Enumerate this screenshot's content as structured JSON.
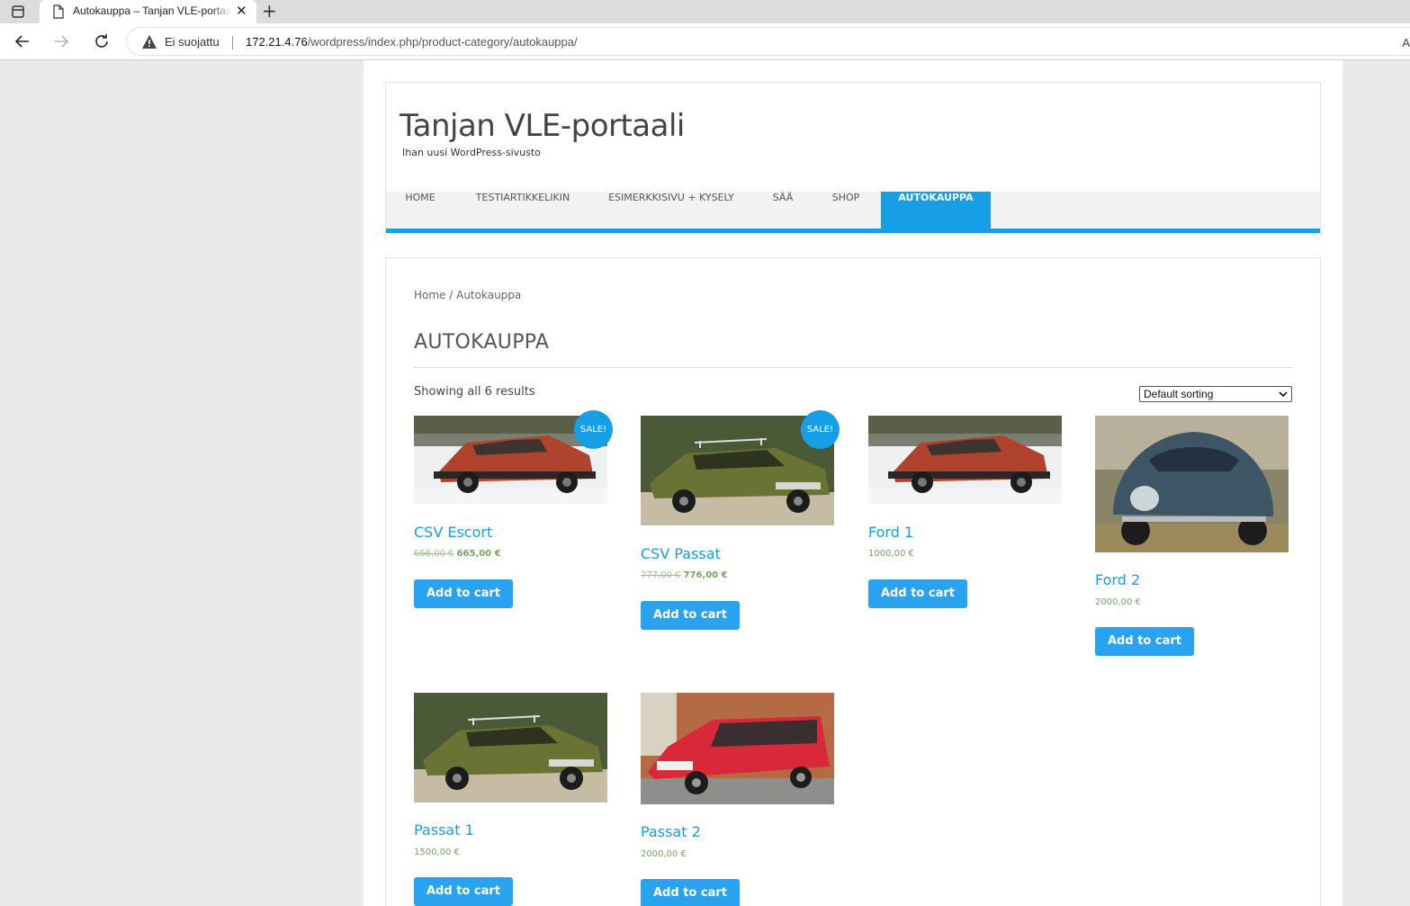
{
  "browser": {
    "tab_title": "Autokauppa – Tanjan VLE-portaali",
    "security_label": "Ei suojattu",
    "url_host": "172.21.4.76",
    "url_path": "/wordpress/index.php/product-category/autokauppa/",
    "new_tab_glyph": "+",
    "close_glyph": "✕",
    "reader_glyph": "A"
  },
  "site": {
    "title": "Tanjan VLE-portaali",
    "description": "Ihan uusi WordPress-sivusto"
  },
  "menu": {
    "items": [
      {
        "label": "Home"
      },
      {
        "label": "Testiartikkelikin"
      },
      {
        "label": "Esimerkkisivu + kysely"
      },
      {
        "label": "Sää"
      },
      {
        "label": "Shop"
      },
      {
        "label": "Autokauppa"
      }
    ],
    "active": "Autokauppa"
  },
  "breadcrumb": "Home / Autokauppa",
  "page_title": "Autokauppa",
  "result_count": "Showing all 6 results",
  "sorting": {
    "selected": "Default sorting"
  },
  "products": [
    {
      "title": "CSV Escort",
      "regular_price": "666,00 €",
      "sale_price": "665,00 €",
      "price": "",
      "sale_badge": "SALE!",
      "button": "Add to cart",
      "image": "red-hatchback-in-snow"
    },
    {
      "title": "CSV Passat",
      "regular_price": "777,00 €",
      "sale_price": "776,00 €",
      "price": "",
      "sale_badge": "SALE!",
      "button": "Add to cart",
      "image": "green-sedan-with-roof-rack"
    },
    {
      "title": "Ford 1",
      "regular_price": "",
      "sale_price": "",
      "price": "1000,00 €",
      "sale_badge": "",
      "button": "Add to cart",
      "image": "red-hatchback-in-snow"
    },
    {
      "title": "Ford 2",
      "regular_price": "",
      "sale_price": "",
      "price": "2000,00 €",
      "sale_badge": "",
      "button": "Add to cart",
      "image": "blue-beetle"
    },
    {
      "title": "Passat 1",
      "regular_price": "",
      "sale_price": "",
      "price": "1500,00 €",
      "sale_badge": "",
      "button": "Add to cart",
      "image": "green-sedan-with-roof-rack"
    },
    {
      "title": "Passat 2",
      "regular_price": "",
      "sale_price": "",
      "price": "2000,00 €",
      "sale_badge": "",
      "button": "Add to cart",
      "image": "red-station-wagon"
    }
  ],
  "colors": {
    "accent": "#169fe6",
    "button": "#29a2ef",
    "price": "#77a464",
    "menu_bg": "#f2f2f2",
    "outer_bg": "#e9e9e9"
  }
}
